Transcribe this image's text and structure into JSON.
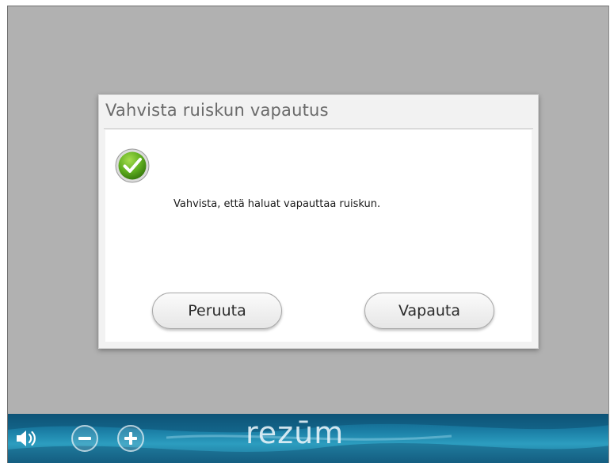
{
  "dialog": {
    "title": "Vahvista ruiskun vapautus",
    "message": "Vahvista, että haluat vapauttaa ruiskun.",
    "cancel_label": "Peruuta",
    "confirm_label": "Vapauta",
    "icon": "check-circle-icon"
  },
  "bottom_bar": {
    "brand": "rezūm",
    "controls": [
      "speaker-icon",
      "volume-down-icon",
      "volume-up-icon"
    ]
  },
  "colors": {
    "background": "#b1b1b1",
    "accent_green": "#5fae1f",
    "bar_blue": "#1b7fa6"
  }
}
